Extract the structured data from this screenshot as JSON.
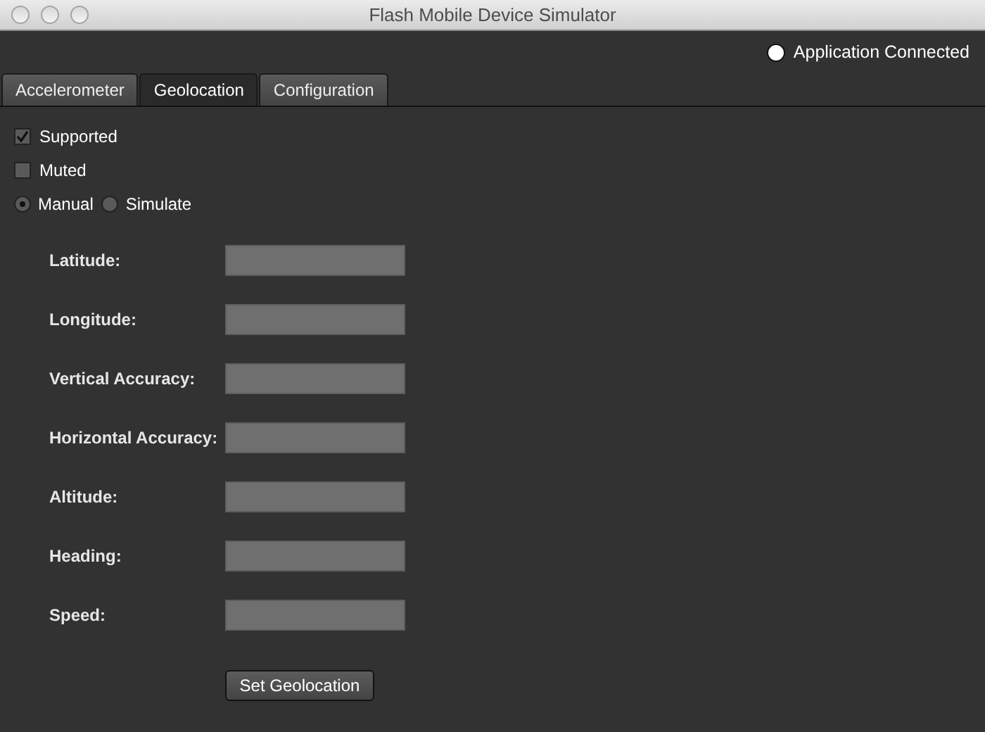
{
  "window": {
    "title": "Flash Mobile Device Simulator"
  },
  "status": {
    "label": "Application Connected",
    "connected": true
  },
  "tabs": [
    {
      "label": "Accelerometer",
      "selected": false
    },
    {
      "label": "Geolocation",
      "selected": true
    },
    {
      "label": "Configuration",
      "selected": false
    }
  ],
  "checkboxes": [
    {
      "label": "Supported",
      "checked": true
    },
    {
      "label": "Muted",
      "checked": false
    }
  ],
  "mode_options": [
    {
      "label": "Manual",
      "selected": true
    },
    {
      "label": "Simulate",
      "selected": false
    }
  ],
  "fields": [
    {
      "label": "Latitude:"
    },
    {
      "label": "Longitude:"
    },
    {
      "label": "Vertical Accuracy:"
    },
    {
      "label": "Horizontal Accuracy:"
    },
    {
      "label": "Altitude:"
    },
    {
      "label": "Heading:"
    },
    {
      "label": "Speed:"
    }
  ],
  "button": "Set Geolocation"
}
